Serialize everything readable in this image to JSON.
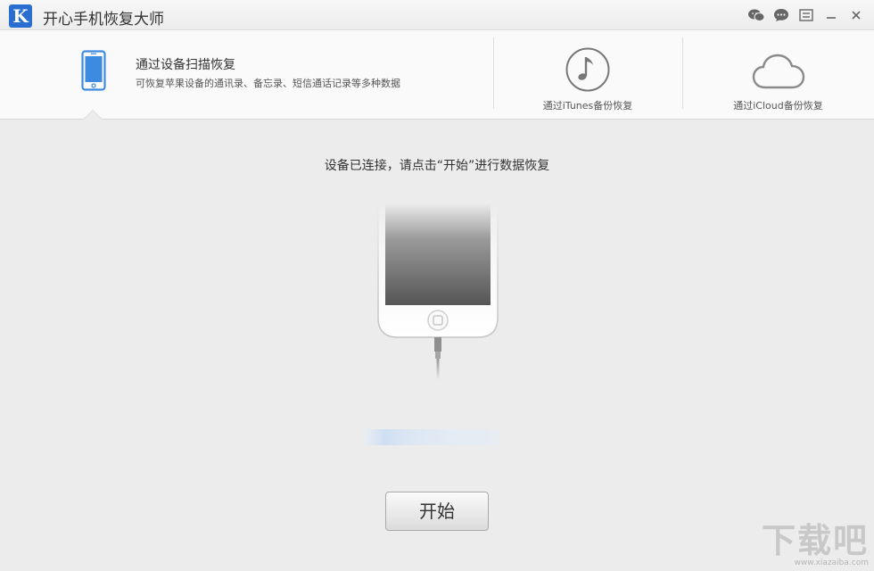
{
  "app": {
    "logo_letter": "K",
    "title": "开心手机恢复大师"
  },
  "window_controls": [
    "wechat-icon",
    "chat-icon",
    "menu-icon",
    "minimize-icon",
    "close-icon"
  ],
  "tabs": {
    "scan": {
      "title": "通过设备扫描恢复",
      "description": "可恢复苹果设备的通讯录、备忘录、短信通话记录等多种数据",
      "icon": "phone-icon",
      "active": true
    },
    "itunes": {
      "label": "通过iTunes备份恢复",
      "icon": "music-note-icon"
    },
    "icloud": {
      "label": "通过iCloud备份恢复",
      "icon": "cloud-icon"
    }
  },
  "main": {
    "status": "设备已连接，请点击“开始”进行数据恢复",
    "start_button": "开始"
  },
  "watermark": {
    "main": "下载吧",
    "url": "www.xiazaiba.com"
  },
  "colors": {
    "accent": "#3c8be0",
    "logo_bg": "#2a6fd0"
  }
}
